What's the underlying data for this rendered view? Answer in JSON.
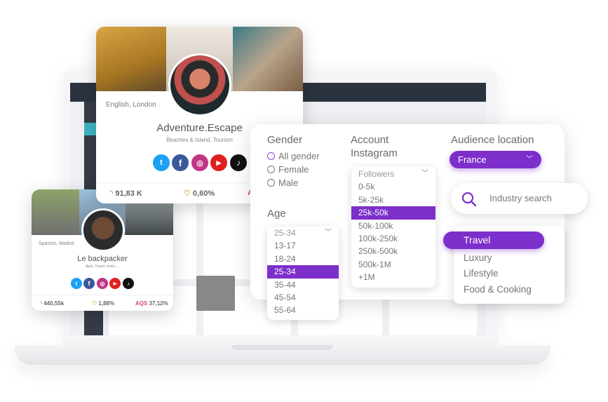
{
  "filters": {
    "gender": {
      "label": "Gender",
      "options": [
        "All gender",
        "Female",
        "Male"
      ],
      "selected": "All gender"
    },
    "age": {
      "label": "Age",
      "value": "25-34",
      "options": [
        "13-17",
        "18-24",
        "25-34",
        "35-44",
        "45-54",
        "55-64"
      ],
      "selected": "25-34"
    },
    "account": {
      "label_line1": "Account",
      "label_line2": "Instagram",
      "placeholder": "Followers",
      "options": [
        "0-5k",
        "5k-25k",
        "25k-50k",
        "50k-100k",
        "100k-250k",
        "250k-500k",
        "500k-1M",
        "+1M"
      ],
      "selected": "25k-50k"
    },
    "location": {
      "label": "Audience location",
      "value": "France"
    },
    "industry": {
      "placeholder": "Industry search",
      "options": [
        "Travel",
        "Luxury",
        "Lifestyle",
        "Food & Cooking"
      ],
      "selected": "Travel"
    }
  },
  "profiles": [
    {
      "location": "English, London",
      "name": "Adventure.Escape",
      "tags": "Beaches & Island, Tourism",
      "followers": "91,83 K",
      "engagement": "0,60%",
      "aqs_label": "A"
    },
    {
      "location": "Spanish, Madrid",
      "name": "Le backpacker",
      "tags": "Auto, Travel, motor ...",
      "followers": "440,55k",
      "engagement": "1,88%",
      "aqs_label": "AQS",
      "aqs": "37,12%"
    }
  ],
  "socials": [
    "twitter",
    "facebook",
    "instagram",
    "youtube",
    "tiktok"
  ],
  "colors": {
    "accent": "#7d2fcb",
    "twitter": "#1da1f2",
    "facebook": "#3b5998",
    "instagram": "#c13584",
    "youtube": "#e02020",
    "tiktok": "#111111"
  }
}
